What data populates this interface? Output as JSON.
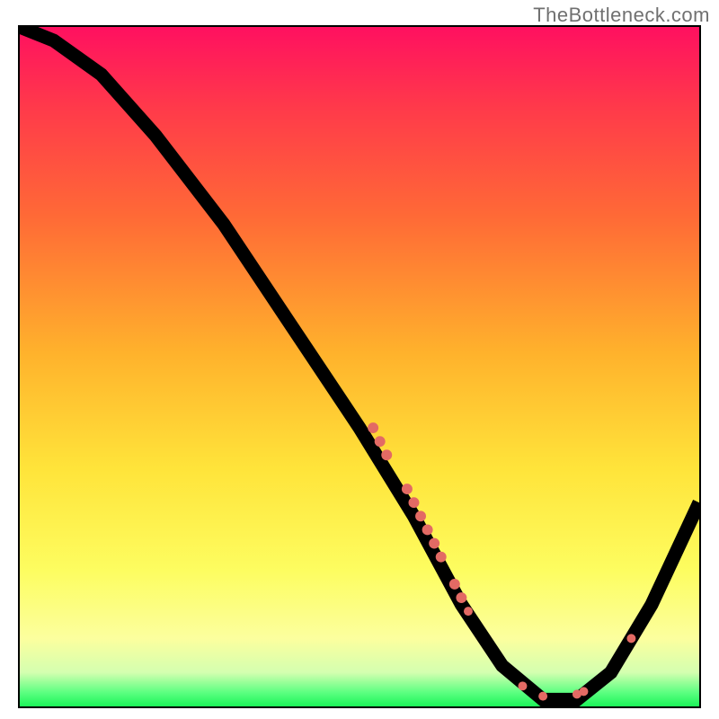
{
  "attribution": "TheBottleneck.com",
  "chart_data": {
    "type": "line",
    "title": "",
    "xlabel": "",
    "ylabel": "",
    "xlim": [
      0,
      100
    ],
    "ylim": [
      0,
      100
    ],
    "series": [
      {
        "name": "curve",
        "points": [
          {
            "x": 0,
            "y": 100
          },
          {
            "x": 5,
            "y": 98
          },
          {
            "x": 12,
            "y": 93
          },
          {
            "x": 20,
            "y": 84
          },
          {
            "x": 30,
            "y": 71
          },
          {
            "x": 40,
            "y": 56
          },
          {
            "x": 50,
            "y": 41
          },
          {
            "x": 58,
            "y": 28
          },
          {
            "x": 65,
            "y": 15
          },
          {
            "x": 71,
            "y": 6
          },
          {
            "x": 77,
            "y": 1
          },
          {
            "x": 82,
            "y": 1
          },
          {
            "x": 87,
            "y": 5
          },
          {
            "x": 93,
            "y": 15
          },
          {
            "x": 100,
            "y": 30
          }
        ]
      }
    ],
    "markers": [
      {
        "x": 52,
        "y": 41,
        "r": 6
      },
      {
        "x": 53,
        "y": 39,
        "r": 6
      },
      {
        "x": 54,
        "y": 37,
        "r": 6
      },
      {
        "x": 57,
        "y": 32,
        "r": 6
      },
      {
        "x": 58,
        "y": 30,
        "r": 6
      },
      {
        "x": 59,
        "y": 28,
        "r": 6
      },
      {
        "x": 60,
        "y": 26,
        "r": 6
      },
      {
        "x": 61,
        "y": 24,
        "r": 6
      },
      {
        "x": 62,
        "y": 22,
        "r": 6
      },
      {
        "x": 64,
        "y": 18,
        "r": 6
      },
      {
        "x": 65,
        "y": 16,
        "r": 6
      },
      {
        "x": 66,
        "y": 14,
        "r": 5
      },
      {
        "x": 74,
        "y": 3,
        "r": 5
      },
      {
        "x": 77,
        "y": 1.5,
        "r": 5
      },
      {
        "x": 82,
        "y": 1.8,
        "r": 5
      },
      {
        "x": 83,
        "y": 2.2,
        "r": 5
      },
      {
        "x": 90,
        "y": 10,
        "r": 5
      }
    ],
    "background_gradient_stops": [
      {
        "pos": 0,
        "color": "#ff1060"
      },
      {
        "pos": 12,
        "color": "#ff3a4a"
      },
      {
        "pos": 28,
        "color": "#ff6a36"
      },
      {
        "pos": 48,
        "color": "#ffb22c"
      },
      {
        "pos": 65,
        "color": "#ffe43a"
      },
      {
        "pos": 80,
        "color": "#fdfd60"
      },
      {
        "pos": 90,
        "color": "#fcff9e"
      },
      {
        "pos": 95,
        "color": "#d4ffb0"
      },
      {
        "pos": 98,
        "color": "#5aff80"
      },
      {
        "pos": 100,
        "color": "#1cf458"
      }
    ]
  }
}
